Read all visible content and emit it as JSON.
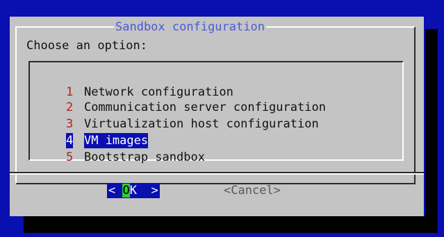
{
  "dialog": {
    "title": "Sandbox configuration",
    "prompt": "Choose an option:"
  },
  "menu": {
    "items": [
      {
        "tag": "1",
        "label": "Network configuration",
        "selected": false
      },
      {
        "tag": "2",
        "label": "Communication server configuration",
        "selected": false
      },
      {
        "tag": "3",
        "label": "Virtualization host configuration",
        "selected": false
      },
      {
        "tag": "4",
        "label": "VM images",
        "selected": true
      },
      {
        "tag": "5",
        "label": "Bootstrap sandbox",
        "selected": false
      }
    ]
  },
  "buttons": {
    "ok_left": "< ",
    "ok_hotkey": "O",
    "ok_rest": "K  >",
    "cancel": "<Cancel>"
  },
  "colors": {
    "background": "#0a0fb0",
    "dialog": "#c4c4c4",
    "title": "#4a5ad8",
    "tag": "#b02020",
    "hotkey": "#2ad22a"
  }
}
